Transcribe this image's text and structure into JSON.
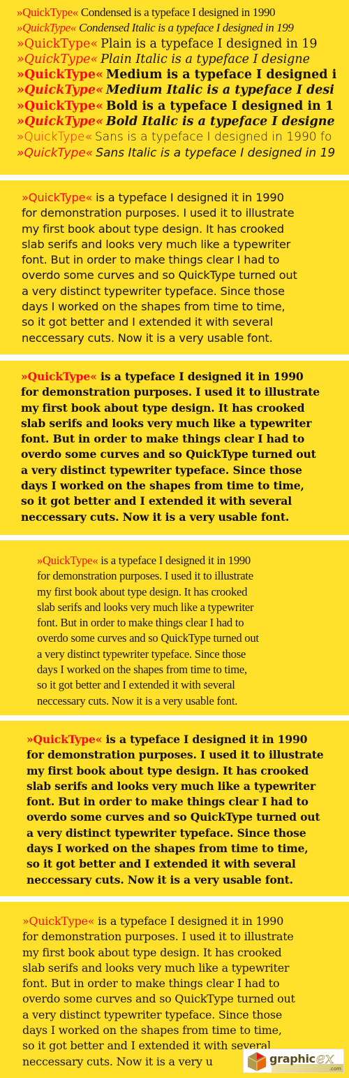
{
  "colors": {
    "panel_background": "#FFE02A",
    "brand_red": "#F01010",
    "text": "#1a1408",
    "separator": "#FFFFFF"
  },
  "brand_name": "»QuickType«",
  "specimen_lines": [
    {
      "style": "Condensed",
      "text": "Condensed is a typeface I designed in 1990"
    },
    {
      "style": "Condensed Italic",
      "text": "Condensed Italic is a typeface I designed in 199"
    },
    {
      "style": "Plain",
      "text": "Plain is a typeface I designed in 19"
    },
    {
      "style": "Plain Italic",
      "text": "Plain Italic is a typeface I designe"
    },
    {
      "style": "Medium",
      "text": "Medium is a typeface I designed i"
    },
    {
      "style": "Medium Italic",
      "text": "Medium Italic is a typeface I desi"
    },
    {
      "style": "Bold",
      "text": "Bold is a typeface I designed in 1"
    },
    {
      "style": "Bold Italic",
      "text": "Bold Italic is a typeface I designe"
    },
    {
      "style": "Sans",
      "text": "Sans is a typeface I designed in 1990 fo"
    },
    {
      "style": "Sans Italic",
      "text": "Sans Italic is a typeface I designed in 19"
    }
  ],
  "paragraphs": [
    {
      "style": "Sans",
      "lines": [
        " is a typeface I designed it in 1990",
        "for demonstration purposes. I used it to illustrate",
        "my first book about type design. It has crooked",
        "slab serifs and looks very much like a typewriter",
        "font. But in order to make things clear I had to",
        "overdo some curves and so QuickType turned out",
        "a very distinct typewriter typeface. Since those",
        "days I worked on the shapes from time to time,",
        "so it got better and I extended it with several",
        "neccessary cuts. Now it is a very usable font."
      ]
    },
    {
      "style": "Bold",
      "lines": [
        " is a typeface I designed it in 1990",
        "for demonstration purposes. I used it to illustrate",
        "my first book about type design. It has crooked",
        "slab serifs and looks very much like a typewriter",
        "font. But in order to make things clear I had to",
        "overdo some curves and so QuickType turned out",
        "a very distinct typewriter typeface. Since those",
        "days I worked on the shapes from time to time,",
        "so it got better and I extended it with several",
        "neccessary cuts. Now it is a very usable font."
      ]
    },
    {
      "style": "Condensed",
      "lines": [
        " is a typeface I designed it in 1990",
        "for demonstration purposes. I used it to illustrate",
        "my first book about type design. It has crooked",
        "slab serifs and looks very much like a typewriter",
        "font. But in order to make things clear I had to",
        "overdo some curves and so QuickType turned out",
        "a very distinct typewriter typeface. Since those",
        "days I worked on the shapes from time to time,",
        "so it got better and I extended it with several",
        "neccessary cuts. Now it is a very usable font."
      ]
    },
    {
      "style": "Medium",
      "lines": [
        " is a typeface I designed it in 1990",
        "for demonstration purposes. I used it to illustrate",
        "my first book about type design. It has crooked",
        "slab serifs and looks very much like a typewriter",
        "font. But in order to make things clear I had to",
        "overdo some curves and so QuickType turned out",
        "a very distinct typewriter typeface. Since those",
        "days I worked on the shapes from time to time,",
        "so it got better and I extended it with several",
        "neccessary cuts. Now it is a very usable font."
      ]
    },
    {
      "style": "Plain",
      "lines": [
        " is a typeface I designed it in 1990",
        "for demonstration purposes. I used it to illustrate",
        "my first book about type design. It has crooked",
        "slab serifs and looks very much like a typewriter",
        "font. But in order to make things clear I had to",
        "overdo some curves and so QuickType turned out",
        "a very distinct typewriter typeface. Since those",
        "days I worked on the shapes from time to time,",
        "so it got better and I extended it with several",
        "neccessary cuts. Now it is a very u"
      ]
    }
  ],
  "watermark": {
    "word": "graphic",
    "suffix": "ex",
    "domain": ".com"
  }
}
